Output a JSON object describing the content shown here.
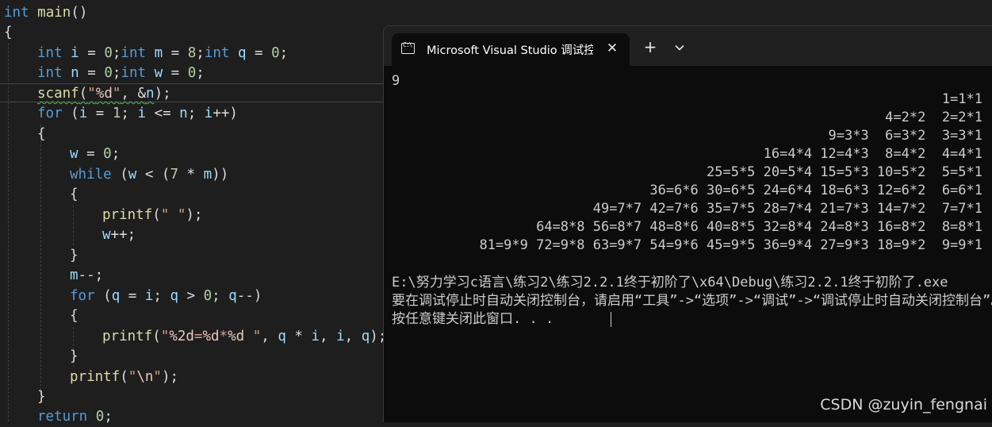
{
  "editor": {
    "lines": [
      {
        "text": "int main()"
      },
      {
        "text": "{"
      },
      {
        "text": "int i = 0;int m = 8;int q = 0;"
      },
      {
        "text": "int n = 0;int w = 0;"
      },
      {
        "text": "scanf(\"%d\", &n);"
      },
      {
        "text": "for (i = 1; i <= n; i++)"
      },
      {
        "text": "{"
      },
      {
        "text": "w = 0;"
      },
      {
        "text": "while (w < (7 * m))"
      },
      {
        "text": "{"
      },
      {
        "text": "printf(\" \");"
      },
      {
        "text": "w++;"
      },
      {
        "text": "}"
      },
      {
        "text": "m--;"
      },
      {
        "text": "for (q = i; q > 0; q--)"
      },
      {
        "text": "{"
      },
      {
        "text": "printf(\"%2d=%d*%d \", q * i, i, q);"
      },
      {
        "text": "}"
      },
      {
        "text": "printf(\"\\n\");"
      },
      {
        "text": "}"
      },
      {
        "text": "return 0;"
      }
    ]
  },
  "terminal": {
    "tab_title": "Microsoft Visual Studio 调试控制台",
    "tab_icon_glyph": "C:\\",
    "close_glyph": "✕",
    "new_tab_glyph": "+",
    "input_echo": "9",
    "table_rows": [
      "1=1*1",
      "4=2*2  2=2*1",
      "9=3*3  6=3*2  3=3*1",
      "16=4*4 12=4*3  8=4*2  4=4*1",
      "25=5*5 20=5*4 15=5*3 10=5*2  5=5*1",
      "36=6*6 30=6*5 24=6*4 18=6*3 12=6*2  6=6*1",
      "49=7*7 42=7*6 35=7*5 28=7*4 21=7*3 14=7*2  7=7*1",
      "64=8*8 56=8*7 48=8*6 40=8*5 32=8*4 24=8*3 16=8*2  8=8*1",
      "81=9*9 72=9*8 63=9*7 54=9*6 45=9*5 36=9*4 27=9*3 18=9*2  9=9*1"
    ],
    "exit_lines": [
      "E:\\努力学习c语言\\练习2\\练习2.2.1终于初阶了\\x64\\Debug\\练习2.2.1终于初阶了.exe",
      "要在调试停止时自动关闭控制台，请启用“工具”->“选项”->“调试”->“调试停止时自动关闭控制台”。",
      "按任意键关闭此窗口. . ."
    ]
  },
  "watermark": "CSDN @zuyin_fengnai",
  "colors": {
    "keyword": "#569cd6",
    "function": "#dcdcaa",
    "number": "#b5cea8",
    "string": "#d69d85",
    "variable": "#9cdcfe",
    "console_text": "#cccccc",
    "console_bg": "#0c0c0c"
  }
}
